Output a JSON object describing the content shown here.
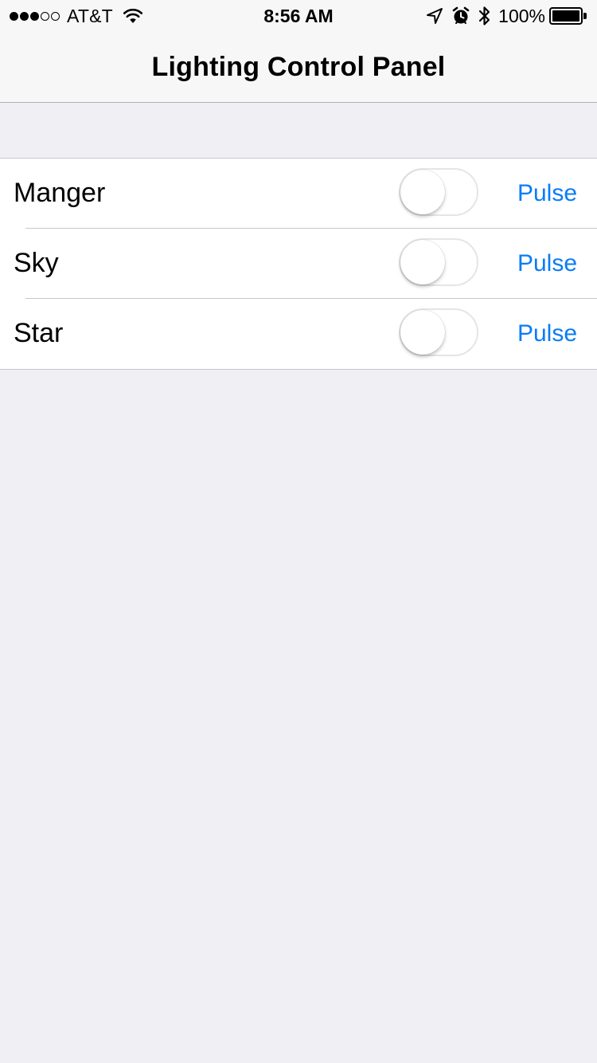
{
  "status_bar": {
    "signal_strength": 3,
    "signal_total": 5,
    "carrier": "AT&T",
    "time": "8:56 AM",
    "battery_percent": "100%",
    "icons": [
      "wifi-icon",
      "location-icon",
      "alarm-icon",
      "bluetooth-icon",
      "battery-icon"
    ]
  },
  "nav": {
    "title": "Lighting Control Panel"
  },
  "lights": [
    {
      "label": "Manger",
      "on": false,
      "pulse_label": "Pulse"
    },
    {
      "label": "Sky",
      "on": false,
      "pulse_label": "Pulse"
    },
    {
      "label": "Star",
      "on": false,
      "pulse_label": "Pulse"
    }
  ],
  "colors": {
    "accent": "#0a7cf7",
    "background": "#efeff4",
    "bar": "#f7f7f7"
  }
}
